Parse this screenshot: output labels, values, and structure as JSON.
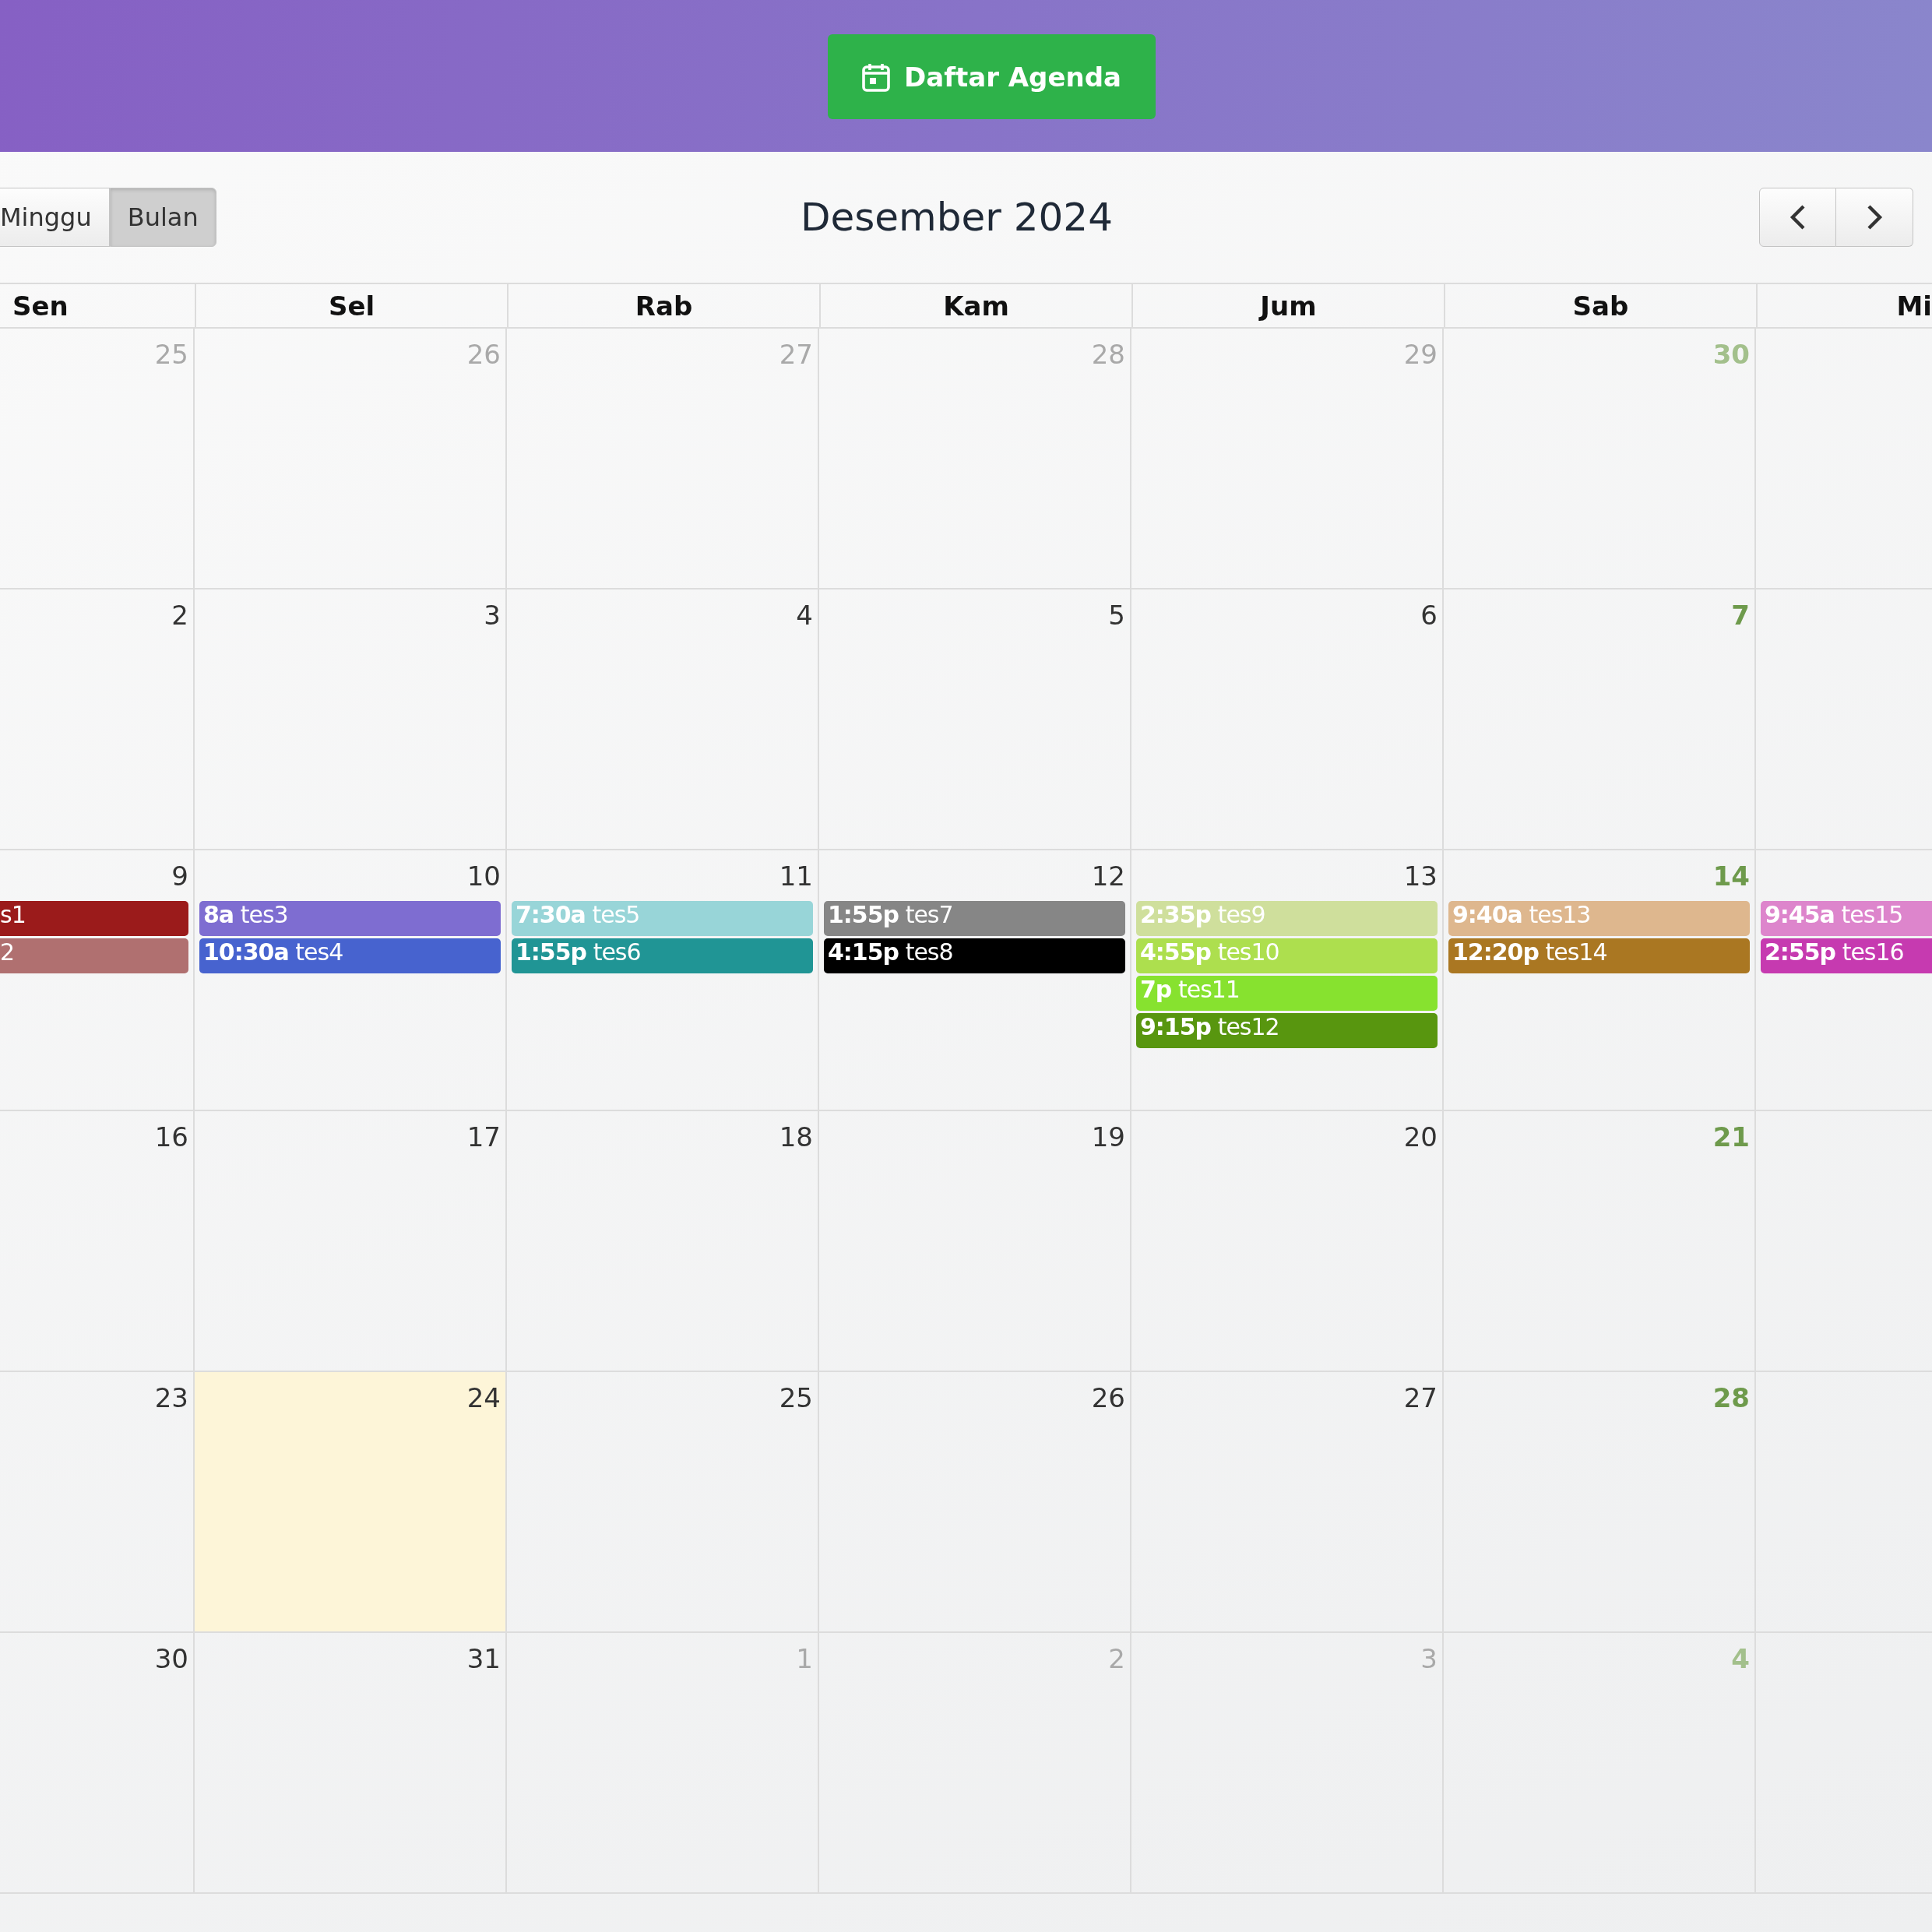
{
  "header": {
    "button": {
      "label": "Daftar Agenda"
    }
  },
  "toolbar": {
    "views": [
      {
        "label": "Minggu",
        "selected": false
      },
      {
        "label": "Bulan",
        "selected": true
      }
    ],
    "title": "Desember 2024"
  },
  "weekdays": [
    "Sen",
    "Sel",
    "Rab",
    "Kam",
    "Jum",
    "Sab",
    "Mi"
  ],
  "weeks": [
    {
      "days": [
        {
          "number": "25",
          "other_month": true,
          "weekend": false,
          "today": false
        },
        {
          "number": "26",
          "other_month": true,
          "weekend": false,
          "today": false
        },
        {
          "number": "27",
          "other_month": true,
          "weekend": false,
          "today": false
        },
        {
          "number": "28",
          "other_month": true,
          "weekend": false,
          "today": false
        },
        {
          "number": "29",
          "other_month": true,
          "weekend": false,
          "today": false
        },
        {
          "number": "30",
          "other_month": true,
          "weekend": true,
          "today": false
        }
      ]
    },
    {
      "days": [
        {
          "number": "2",
          "other_month": false,
          "weekend": false,
          "today": false
        },
        {
          "number": "3",
          "other_month": false,
          "weekend": false,
          "today": false
        },
        {
          "number": "4",
          "other_month": false,
          "weekend": false,
          "today": false
        },
        {
          "number": "5",
          "other_month": false,
          "weekend": false,
          "today": false
        },
        {
          "number": "6",
          "other_month": false,
          "weekend": false,
          "today": false
        },
        {
          "number": "7",
          "other_month": false,
          "weekend": true,
          "today": false
        }
      ]
    },
    {
      "days": [
        {
          "number": "9",
          "other_month": false,
          "weekend": false,
          "today": false,
          "events": [
            {
              "title": "s1",
              "color": "#9b1b1b"
            },
            {
              "title": "2",
              "color": "#b07070"
            }
          ]
        },
        {
          "number": "10",
          "other_month": false,
          "weekend": false,
          "today": false,
          "events": [
            {
              "time": "8a",
              "title": "tes3",
              "color": "#7e6dd1"
            },
            {
              "time": "10:30a",
              "title": "tes4",
              "color": "#4763cf"
            }
          ]
        },
        {
          "number": "11",
          "other_month": false,
          "weekend": false,
          "today": false,
          "events": [
            {
              "time": "7:30a",
              "title": "tes5",
              "color": "#98d5d8"
            },
            {
              "time": "1:55p",
              "title": "tes6",
              "color": "#209595"
            }
          ]
        },
        {
          "number": "12",
          "other_month": false,
          "weekend": false,
          "today": false,
          "events": [
            {
              "time": "1:55p",
              "title": "tes7",
              "color": "#868686"
            },
            {
              "time": "4:15p",
              "title": "tes8",
              "color": "#000000"
            }
          ]
        },
        {
          "number": "13",
          "other_month": false,
          "weekend": false,
          "today": false,
          "events": [
            {
              "time": "2:35p",
              "title": "tes9",
              "color": "#cfdf9c"
            },
            {
              "time": "4:55p",
              "title": "tes10",
              "color": "#addf4e"
            },
            {
              "time": "7p",
              "title": "tes11",
              "color": "#87e22f"
            },
            {
              "time": "9:15p",
              "title": "tes12",
              "color": "#58960f"
            }
          ]
        },
        {
          "number": "14",
          "other_month": false,
          "weekend": true,
          "today": false,
          "events": [
            {
              "time": "9:40a",
              "title": "tes13",
              "color": "#deb78e"
            },
            {
              "time": "12:20p",
              "title": "tes14",
              "color": "#aa7722"
            }
          ]
        },
        {
          "events": [
            {
              "time": "9:45a",
              "title": "tes15",
              "color": "#dd85cc"
            },
            {
              "time": "2:55p",
              "title": "tes16",
              "color": "#c63ab0"
            }
          ]
        }
      ]
    },
    {
      "days": [
        {
          "number": "16",
          "other_month": false,
          "weekend": false,
          "today": false
        },
        {
          "number": "17",
          "other_month": false,
          "weekend": false,
          "today": false
        },
        {
          "number": "18",
          "other_month": false,
          "weekend": false,
          "today": false
        },
        {
          "number": "19",
          "other_month": false,
          "weekend": false,
          "today": false
        },
        {
          "number": "20",
          "other_month": false,
          "weekend": false,
          "today": false
        },
        {
          "number": "21",
          "other_month": false,
          "weekend": true,
          "today": false
        }
      ]
    },
    {
      "days": [
        {
          "number": "23",
          "other_month": false,
          "weekend": false,
          "today": false
        },
        {
          "number": "24",
          "other_month": false,
          "weekend": false,
          "today": true
        },
        {
          "number": "25",
          "other_month": false,
          "weekend": false,
          "today": false
        },
        {
          "number": "26",
          "other_month": false,
          "weekend": false,
          "today": false
        },
        {
          "number": "27",
          "other_month": false,
          "weekend": false,
          "today": false
        },
        {
          "number": "28",
          "other_month": false,
          "weekend": true,
          "today": false
        }
      ]
    },
    {
      "days": [
        {
          "number": "30",
          "other_month": false,
          "weekend": false,
          "today": false
        },
        {
          "number": "31",
          "other_month": false,
          "weekend": false,
          "today": false
        },
        {
          "number": "1",
          "other_month": true,
          "weekend": false,
          "today": false
        },
        {
          "number": "2",
          "other_month": true,
          "weekend": false,
          "today": false
        },
        {
          "number": "3",
          "other_month": true,
          "weekend": false,
          "today": false
        },
        {
          "number": "4",
          "other_month": true,
          "weekend": true,
          "today": false
        }
      ]
    }
  ]
}
